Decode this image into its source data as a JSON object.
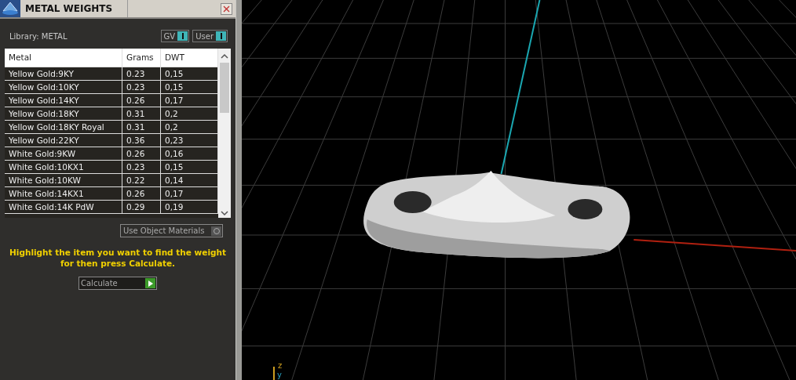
{
  "panel": {
    "title": "METAL WEIGHTS",
    "library_label": "Library: METAL",
    "toggles": [
      {
        "label": "GV",
        "on": true
      },
      {
        "label": "User",
        "on": true
      }
    ]
  },
  "table": {
    "columns": [
      "Metal",
      "Grams",
      "DWT"
    ],
    "rows": [
      {
        "metal": "Yellow Gold:9KY",
        "grams": "0.23",
        "dwt": "0,15",
        "selected": false
      },
      {
        "metal": "Yellow Gold:10KY",
        "grams": "0.23",
        "dwt": "0,15",
        "selected": false
      },
      {
        "metal": "Yellow Gold:14KY",
        "grams": "0.26",
        "dwt": "0,17",
        "selected": false
      },
      {
        "metal": "Yellow Gold:18KY",
        "grams": "0.31",
        "dwt": "0,2",
        "selected": false
      },
      {
        "metal": "Yellow Gold:18KY Royal",
        "grams": "0.31",
        "dwt": "0,2",
        "selected": false
      },
      {
        "metal": "Yellow Gold:22KY",
        "grams": "0.36",
        "dwt": "0,23",
        "selected": false
      },
      {
        "metal": "White Gold:9KW",
        "grams": "0.26",
        "dwt": "0,16",
        "selected": false
      },
      {
        "metal": "White Gold:10KX1",
        "grams": "0.23",
        "dwt": "0,15",
        "selected": false
      },
      {
        "metal": "White Gold:10KW",
        "grams": "0.22",
        "dwt": "0,14",
        "selected": false
      },
      {
        "metal": "White Gold:14KX1",
        "grams": "0.26",
        "dwt": "0,17",
        "selected": false
      },
      {
        "metal": "White Gold:14K PdW",
        "grams": "0.29",
        "dwt": "0,19",
        "selected": false
      }
    ]
  },
  "object_materials": {
    "label": "Use Object Materials",
    "on": false
  },
  "hint": "Highlight the item you want to find the weight for then press Calculate.",
  "calculate_button": "Calculate",
  "viewport": {
    "gizmo_labels": [
      "z",
      "y"
    ]
  }
}
